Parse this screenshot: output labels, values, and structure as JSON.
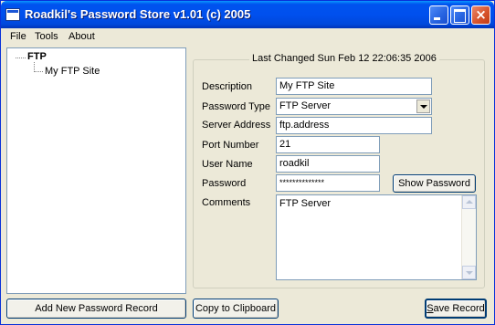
{
  "window": {
    "title": "Roadkil's Password Store v1.01 (c) 2005",
    "close_glyph": "×"
  },
  "menu": {
    "file": "File",
    "tools": "Tools",
    "about": "About"
  },
  "tree": {
    "root_label": "FTP",
    "child_label": "My FTP Site"
  },
  "record": {
    "group_title": "Last Changed Sun Feb 12 22:06:35 2006",
    "description_label": "Description",
    "description_value": "My FTP Site",
    "password_type_label": "Password Type",
    "password_type_value": "FTP Server",
    "server_address_label": "Server Address",
    "server_address_value": "ftp.address",
    "port_number_label": "Port Number",
    "port_number_value": "21",
    "user_name_label": "User Name",
    "user_name_value": "roadkil",
    "password_label": "Password",
    "password_value": "**************",
    "comments_label": "Comments",
    "comments_value": "FTP Server"
  },
  "buttons": {
    "show_password": "Show Password",
    "add_record": "Add New Password Record",
    "copy_clipboard": "Copy to Clipboard",
    "save_record_accel": "S",
    "save_record_rest": "ave Record"
  },
  "icons": {
    "app": "app-window-icon",
    "minimize": "minimize-icon",
    "maximize": "maximize-icon",
    "close": "close-icon",
    "dropdown": "chevron-down-icon",
    "scroll_up": "scroll-up-arrow-icon",
    "scroll_down": "scroll-down-arrow-icon"
  },
  "colors": {
    "titlebar": "#0053ee",
    "window_bg": "#ece9d8",
    "close_button": "#d5512a",
    "field_border": "#7f9db9"
  }
}
